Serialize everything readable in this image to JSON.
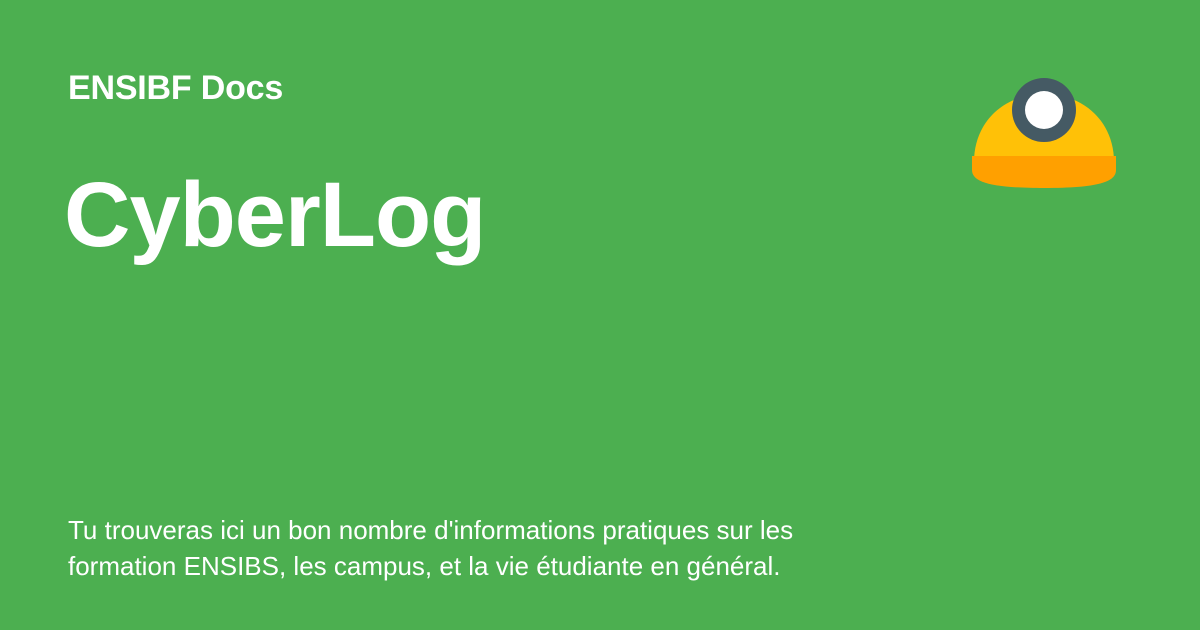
{
  "site": {
    "name": "ENSIBF Docs"
  },
  "page": {
    "title": "CyberLog",
    "description": "Tu trouveras ici un bon nombre d'informations pratiques sur les formation ENSIBS, les campus, et la vie étudiante en général."
  },
  "logo": {
    "icon": "miner-helmet-icon"
  },
  "colors": {
    "background": "#4caf50",
    "text": "#ffffff",
    "helmet_yellow": "#ffc107",
    "helmet_brim": "#ffa000",
    "lamp_ring": "#455a64",
    "lamp_light": "#ffffff"
  }
}
